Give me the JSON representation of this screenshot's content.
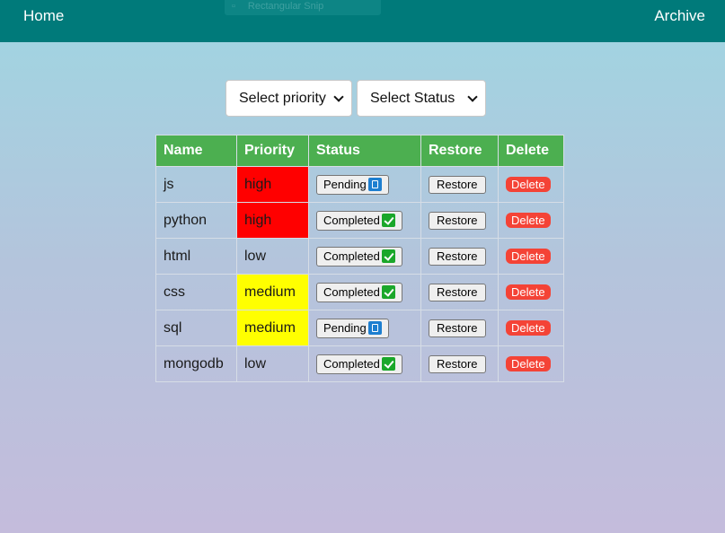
{
  "nav": {
    "home_label": "Home",
    "archive_label": "Archive",
    "bg_color": "#007a7a"
  },
  "overlay": {
    "label": "Rectangular Snip"
  },
  "filters": {
    "priority_selected": "Select priority",
    "status_selected": "Select Status"
  },
  "table": {
    "headers": {
      "name": "Name",
      "priority": "Priority",
      "status": "Status",
      "restore": "Restore",
      "delete": "Delete"
    },
    "header_color": "#4caf50",
    "rows": [
      {
        "name": "js",
        "priority": "high",
        "status": "Pending",
        "status_icon": "pending-emoji-icon",
        "restore": "Restore",
        "delete": "Delete"
      },
      {
        "name": "python",
        "priority": "high",
        "status": "Completed",
        "status_icon": "check-mark-emoji-icon",
        "restore": "Restore",
        "delete": "Delete"
      },
      {
        "name": "html",
        "priority": "low",
        "status": "Completed",
        "status_icon": "check-mark-emoji-icon",
        "restore": "Restore",
        "delete": "Delete"
      },
      {
        "name": "css",
        "priority": "medium",
        "status": "Completed",
        "status_icon": "check-mark-emoji-icon",
        "restore": "Restore",
        "delete": "Delete"
      },
      {
        "name": "sql",
        "priority": "medium",
        "status": "Pending",
        "status_icon": "pending-emoji-icon",
        "restore": "Restore",
        "delete": "Delete"
      },
      {
        "name": "mongodb",
        "priority": "low",
        "status": "Completed",
        "status_icon": "check-mark-emoji-icon",
        "restore": "Restore",
        "delete": "Delete"
      }
    ],
    "priority_colors": {
      "high": "#ff0000",
      "medium": "#ffff00",
      "low": "transparent"
    },
    "delete_color": "#f44336"
  }
}
